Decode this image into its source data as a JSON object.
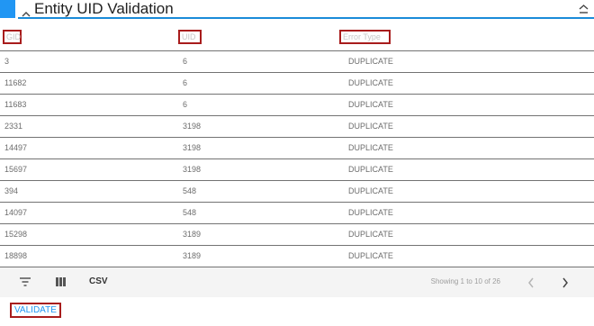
{
  "section": {
    "title": "Entity UID Validation"
  },
  "table": {
    "headers": [
      "GID",
      "UID",
      "Error Type"
    ],
    "rows": [
      [
        "3",
        "6",
        "DUPLICATE"
      ],
      [
        "11682",
        "6",
        "DUPLICATE"
      ],
      [
        "11683",
        "6",
        "DUPLICATE"
      ],
      [
        "2331",
        "3198",
        "DUPLICATE"
      ],
      [
        "14497",
        "3198",
        "DUPLICATE"
      ],
      [
        "15697",
        "3198",
        "DUPLICATE"
      ],
      [
        "394",
        "548",
        "DUPLICATE"
      ],
      [
        "14097",
        "548",
        "DUPLICATE"
      ],
      [
        "15298",
        "3189",
        "DUPLICATE"
      ],
      [
        "18898",
        "3189",
        "DUPLICATE"
      ]
    ]
  },
  "toolbar": {
    "filter_icon": "filter-icon",
    "columns_icon": "columns-icon",
    "csv_label": "CSV",
    "pagination_text": "Showing 1 to 10 of 26"
  },
  "actions": {
    "validate_label": "VALIDATE"
  },
  "colors": {
    "accent": "#2196f3",
    "highlight_border": "#a81c1c"
  }
}
